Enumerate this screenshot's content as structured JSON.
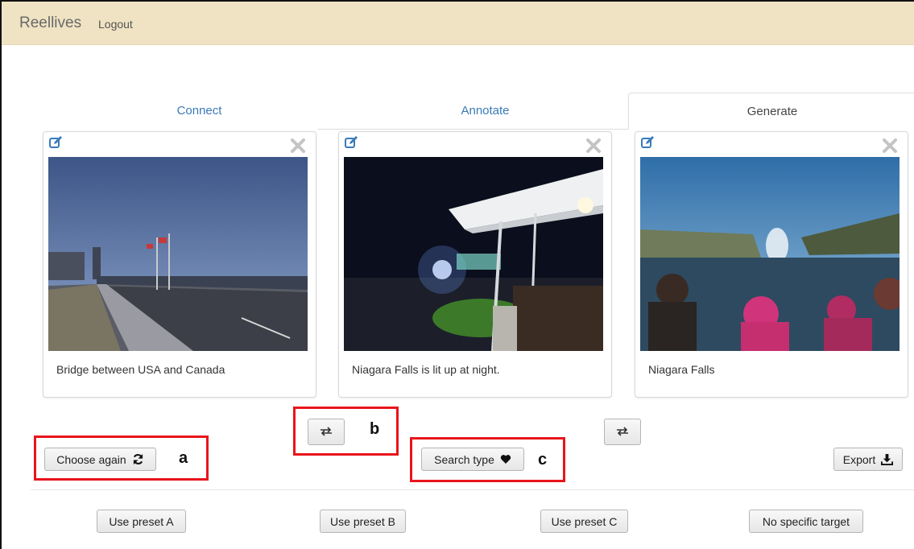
{
  "navbar": {
    "brand": "Reellives",
    "logout": "Logout"
  },
  "tabs": [
    {
      "label": "Connect",
      "active": false
    },
    {
      "label": "Annotate",
      "active": false
    },
    {
      "label": "Generate",
      "active": true
    }
  ],
  "cards": [
    {
      "caption": "Bridge between USA and Canada",
      "photo": "bridge-photo"
    },
    {
      "caption": "Niagara Falls is lit up at night.",
      "photo": "night-terrace-photo"
    },
    {
      "caption": "Niagara Falls",
      "photo": "falls-boat-photo"
    }
  ],
  "actions": {
    "choose_again": "Choose again",
    "search_type": "Search type",
    "export": "Export"
  },
  "presets": [
    "Use preset A",
    "Use preset B",
    "Use preset C",
    "No specific target"
  ],
  "callouts": {
    "a": "a",
    "b": "b",
    "c": "c"
  },
  "colors": {
    "navbar": "#efe3c3",
    "link": "#3a7ab8",
    "callout": "#e8151b"
  }
}
